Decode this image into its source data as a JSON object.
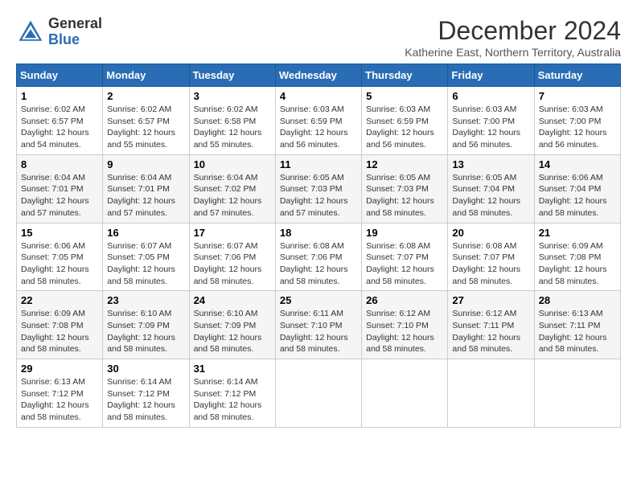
{
  "header": {
    "logo_general": "General",
    "logo_blue": "Blue",
    "month_title": "December 2024",
    "location": "Katherine East, Northern Territory, Australia"
  },
  "weekdays": [
    "Sunday",
    "Monday",
    "Tuesday",
    "Wednesday",
    "Thursday",
    "Friday",
    "Saturday"
  ],
  "weeks": [
    [
      {
        "day": "1",
        "sunrise": "6:02 AM",
        "sunset": "6:57 PM",
        "daylight": "12 hours and 54 minutes."
      },
      {
        "day": "2",
        "sunrise": "6:02 AM",
        "sunset": "6:57 PM",
        "daylight": "12 hours and 55 minutes."
      },
      {
        "day": "3",
        "sunrise": "6:02 AM",
        "sunset": "6:58 PM",
        "daylight": "12 hours and 55 minutes."
      },
      {
        "day": "4",
        "sunrise": "6:03 AM",
        "sunset": "6:59 PM",
        "daylight": "12 hours and 56 minutes."
      },
      {
        "day": "5",
        "sunrise": "6:03 AM",
        "sunset": "6:59 PM",
        "daylight": "12 hours and 56 minutes."
      },
      {
        "day": "6",
        "sunrise": "6:03 AM",
        "sunset": "7:00 PM",
        "daylight": "12 hours and 56 minutes."
      },
      {
        "day": "7",
        "sunrise": "6:03 AM",
        "sunset": "7:00 PM",
        "daylight": "12 hours and 56 minutes."
      }
    ],
    [
      {
        "day": "8",
        "sunrise": "6:04 AM",
        "sunset": "7:01 PM",
        "daylight": "12 hours and 57 minutes."
      },
      {
        "day": "9",
        "sunrise": "6:04 AM",
        "sunset": "7:01 PM",
        "daylight": "12 hours and 57 minutes."
      },
      {
        "day": "10",
        "sunrise": "6:04 AM",
        "sunset": "7:02 PM",
        "daylight": "12 hours and 57 minutes."
      },
      {
        "day": "11",
        "sunrise": "6:05 AM",
        "sunset": "7:03 PM",
        "daylight": "12 hours and 57 minutes."
      },
      {
        "day": "12",
        "sunrise": "6:05 AM",
        "sunset": "7:03 PM",
        "daylight": "12 hours and 58 minutes."
      },
      {
        "day": "13",
        "sunrise": "6:05 AM",
        "sunset": "7:04 PM",
        "daylight": "12 hours and 58 minutes."
      },
      {
        "day": "14",
        "sunrise": "6:06 AM",
        "sunset": "7:04 PM",
        "daylight": "12 hours and 58 minutes."
      }
    ],
    [
      {
        "day": "15",
        "sunrise": "6:06 AM",
        "sunset": "7:05 PM",
        "daylight": "12 hours and 58 minutes."
      },
      {
        "day": "16",
        "sunrise": "6:07 AM",
        "sunset": "7:05 PM",
        "daylight": "12 hours and 58 minutes."
      },
      {
        "day": "17",
        "sunrise": "6:07 AM",
        "sunset": "7:06 PM",
        "daylight": "12 hours and 58 minutes."
      },
      {
        "day": "18",
        "sunrise": "6:08 AM",
        "sunset": "7:06 PM",
        "daylight": "12 hours and 58 minutes."
      },
      {
        "day": "19",
        "sunrise": "6:08 AM",
        "sunset": "7:07 PM",
        "daylight": "12 hours and 58 minutes."
      },
      {
        "day": "20",
        "sunrise": "6:08 AM",
        "sunset": "7:07 PM",
        "daylight": "12 hours and 58 minutes."
      },
      {
        "day": "21",
        "sunrise": "6:09 AM",
        "sunset": "7:08 PM",
        "daylight": "12 hours and 58 minutes."
      }
    ],
    [
      {
        "day": "22",
        "sunrise": "6:09 AM",
        "sunset": "7:08 PM",
        "daylight": "12 hours and 58 minutes."
      },
      {
        "day": "23",
        "sunrise": "6:10 AM",
        "sunset": "7:09 PM",
        "daylight": "12 hours and 58 minutes."
      },
      {
        "day": "24",
        "sunrise": "6:10 AM",
        "sunset": "7:09 PM",
        "daylight": "12 hours and 58 minutes."
      },
      {
        "day": "25",
        "sunrise": "6:11 AM",
        "sunset": "7:10 PM",
        "daylight": "12 hours and 58 minutes."
      },
      {
        "day": "26",
        "sunrise": "6:12 AM",
        "sunset": "7:10 PM",
        "daylight": "12 hours and 58 minutes."
      },
      {
        "day": "27",
        "sunrise": "6:12 AM",
        "sunset": "7:11 PM",
        "daylight": "12 hours and 58 minutes."
      },
      {
        "day": "28",
        "sunrise": "6:13 AM",
        "sunset": "7:11 PM",
        "daylight": "12 hours and 58 minutes."
      }
    ],
    [
      {
        "day": "29",
        "sunrise": "6:13 AM",
        "sunset": "7:12 PM",
        "daylight": "12 hours and 58 minutes."
      },
      {
        "day": "30",
        "sunrise": "6:14 AM",
        "sunset": "7:12 PM",
        "daylight": "12 hours and 58 minutes."
      },
      {
        "day": "31",
        "sunrise": "6:14 AM",
        "sunset": "7:12 PM",
        "daylight": "12 hours and 58 minutes."
      },
      null,
      null,
      null,
      null
    ]
  ]
}
